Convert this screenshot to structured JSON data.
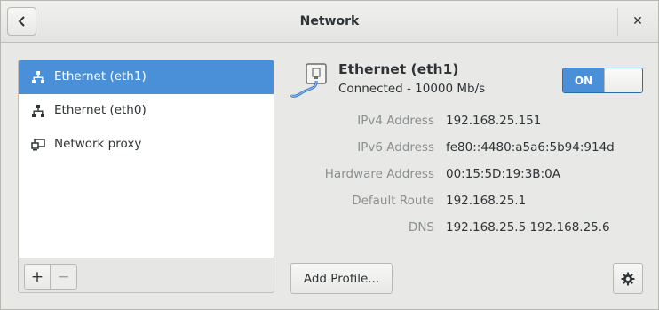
{
  "window": {
    "title": "Network"
  },
  "headerbar": {
    "back_icon": "go-previous-icon",
    "close_icon": "window-close-icon",
    "close_glyph": "✕"
  },
  "sidebar": {
    "items": [
      {
        "label": "Ethernet (eth1)",
        "icon": "network-wired-icon",
        "selected": true
      },
      {
        "label": "Ethernet (eth0)",
        "icon": "network-wired-icon",
        "selected": false
      },
      {
        "label": "Network proxy",
        "icon": "network-proxy-icon",
        "selected": false
      }
    ],
    "toolbar": {
      "add_label": "+",
      "remove_label": "−"
    }
  },
  "device": {
    "name": "Ethernet (eth1)",
    "status": "Connected - 10000 Mb/s",
    "icon": "ethernet-cable-icon",
    "switch_label": "ON",
    "switch_state": true
  },
  "properties": [
    {
      "label": "IPv4 Address",
      "value": "192.168.25.151"
    },
    {
      "label": "IPv6 Address",
      "value": "fe80::4480:a5a6:5b94:914d"
    },
    {
      "label": "Hardware Address",
      "value": "00:15:5D:19:3B:0A"
    },
    {
      "label": "Default Route",
      "value": "192.168.25.1"
    },
    {
      "label": "DNS",
      "value": "192.168.25.5 192.168.25.6"
    }
  ],
  "actions": {
    "add_profile_label": "Add Profile...",
    "settings_icon": "gear-icon"
  },
  "colors": {
    "accent": "#4a90d9",
    "label_gray": "#8a8f90",
    "text": "#2e3436"
  }
}
